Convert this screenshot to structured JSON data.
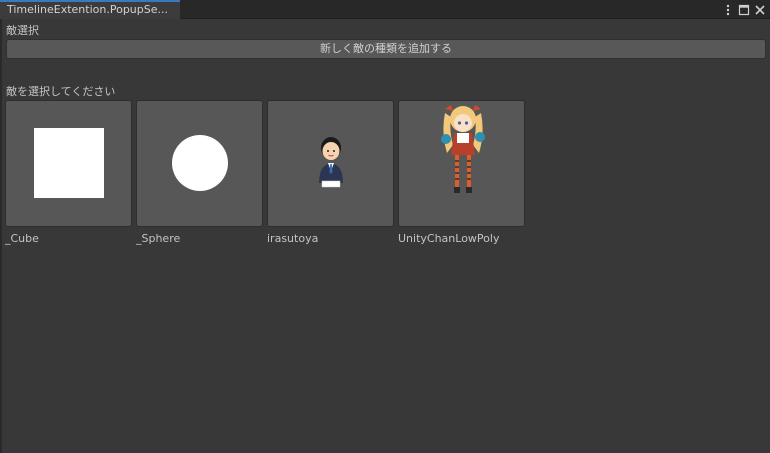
{
  "window": {
    "tab_title": "TimelineExtention.PopupSe...",
    "actions": {
      "menu_icon": "kebab-menu-icon",
      "maximize_icon": "maximize-icon",
      "close_icon": "close-icon"
    }
  },
  "panel": {
    "section_label": "敵選択",
    "add_button_label": "新しく敵の種類を追加する",
    "select_prompt": "敵を選択してください"
  },
  "enemies": [
    {
      "name": "_Cube",
      "icon": "cube-icon"
    },
    {
      "name": "_Sphere",
      "icon": "sphere-icon"
    },
    {
      "name": "irasutoya",
      "icon": "businessman-icon"
    },
    {
      "name": "UnityChanLowPoly",
      "icon": "anime-girl-icon"
    }
  ]
}
